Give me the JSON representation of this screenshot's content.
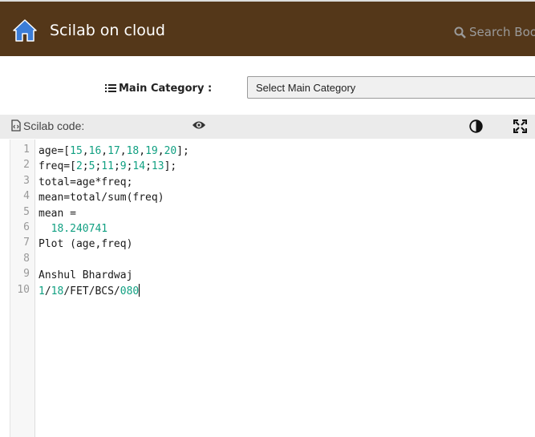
{
  "header": {
    "title": "Scilab on cloud",
    "search_placeholder": "Search Boo"
  },
  "category": {
    "label": "Main Category :",
    "selected": "Select Main Category"
  },
  "editor": {
    "label": "Scilab code:",
    "lines": [
      {
        "n": "1",
        "parts": [
          {
            "t": "age=["
          },
          {
            "t": "15",
            "c": "num"
          },
          {
            "t": ","
          },
          {
            "t": "16",
            "c": "num"
          },
          {
            "t": ","
          },
          {
            "t": "17",
            "c": "num"
          },
          {
            "t": ","
          },
          {
            "t": "18",
            "c": "num"
          },
          {
            "t": ","
          },
          {
            "t": "19",
            "c": "num"
          },
          {
            "t": ","
          },
          {
            "t": "20",
            "c": "num"
          },
          {
            "t": "];"
          }
        ]
      },
      {
        "n": "2",
        "parts": [
          {
            "t": "freq=["
          },
          {
            "t": "2",
            "c": "num"
          },
          {
            "t": ";"
          },
          {
            "t": "5",
            "c": "num"
          },
          {
            "t": ";"
          },
          {
            "t": "11",
            "c": "num"
          },
          {
            "t": ";"
          },
          {
            "t": "9",
            "c": "num"
          },
          {
            "t": ";"
          },
          {
            "t": "14",
            "c": "num"
          },
          {
            "t": ";"
          },
          {
            "t": "13",
            "c": "num"
          },
          {
            "t": "];"
          }
        ]
      },
      {
        "n": "3",
        "parts": [
          {
            "t": "total=age*freq;"
          }
        ]
      },
      {
        "n": "4",
        "parts": [
          {
            "t": "mean=total/sum(freq)"
          }
        ]
      },
      {
        "n": "5",
        "parts": [
          {
            "t": "mean ="
          }
        ]
      },
      {
        "n": "6",
        "parts": [
          {
            "t": "  "
          },
          {
            "t": "18.240741",
            "c": "num"
          }
        ]
      },
      {
        "n": "7",
        "parts": [
          {
            "t": "Plot (age,freq)"
          }
        ]
      },
      {
        "n": "8",
        "parts": []
      },
      {
        "n": "9",
        "parts": [
          {
            "t": "Anshul Bhardwaj"
          }
        ]
      },
      {
        "n": "10",
        "parts": [
          {
            "t": "1",
            "c": "num"
          },
          {
            "t": "/"
          },
          {
            "t": "18",
            "c": "num"
          },
          {
            "t": "/FET/BCS/"
          },
          {
            "t": "080",
            "c": "num"
          }
        ]
      }
    ]
  }
}
